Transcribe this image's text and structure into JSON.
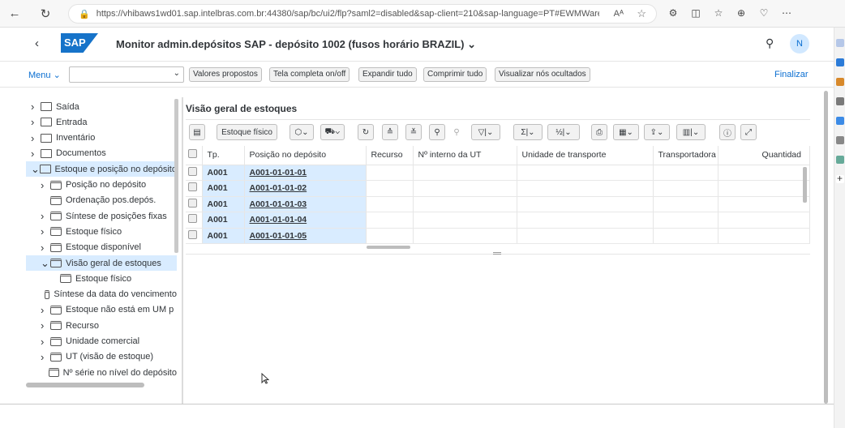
{
  "browser": {
    "url": "https://vhibaws1wd01.sap.intelbras.com.br:44380/sap/bc/ui2/flp?saml2=disabled&sap-client=210&sap-language=PT#EWMWareh...",
    "read_aloud": "Aᴬ"
  },
  "shell": {
    "title": "Monitor admin.depósitos SAP - depósito 1002 (fusos horário BRAZIL)",
    "title_chevron": "⌄",
    "avatar": "N",
    "logo": "SAP"
  },
  "toolbar": {
    "menu": "Menu",
    "buttons": [
      "Valores propostos",
      "Tela completa on/off",
      "Expandir tudo",
      "Comprimir tudo",
      "Visualizar nós ocultados"
    ],
    "finalizar": "Finalizar"
  },
  "tree": [
    {
      "label": "Saída",
      "icon": "folder-icon",
      "level": 0,
      "arrow": ">"
    },
    {
      "label": "Entrada",
      "icon": "folder-icon",
      "level": 0,
      "arrow": ">"
    },
    {
      "label": "Inventário",
      "icon": "folder-icon",
      "level": 0,
      "arrow": ">"
    },
    {
      "label": "Documentos",
      "icon": "folder-icon",
      "level": 0,
      "arrow": ">"
    },
    {
      "label": "Estoque e posição no depósito",
      "icon": "folder-open-icon",
      "level": 0,
      "arrow": "v",
      "selected": true
    },
    {
      "label": "Posição no depósito",
      "icon": "node-icon",
      "level": 1,
      "arrow": ">"
    },
    {
      "label": "Ordenação pos.depós.",
      "icon": "node-icon",
      "level": 1,
      "arrow": ""
    },
    {
      "label": "Síntese de posições fixas",
      "icon": "node-icon",
      "level": 1,
      "arrow": ">"
    },
    {
      "label": "Estoque físico",
      "icon": "node-icon",
      "level": 1,
      "arrow": ">"
    },
    {
      "label": "Estoque disponível",
      "icon": "node-icon",
      "level": 1,
      "arrow": ">"
    },
    {
      "label": "Visão geral de estoques",
      "icon": "node-icon",
      "level": 1,
      "arrow": "v",
      "selected": true
    },
    {
      "label": "Estoque físico",
      "icon": "node-icon",
      "level": 2,
      "arrow": "",
      "selected": true
    },
    {
      "label": "Síntese da data do vencimento",
      "icon": "node-icon",
      "level": 1,
      "arrow": ""
    },
    {
      "label": "Estoque não está em UM p",
      "icon": "node-icon",
      "level": 1,
      "arrow": ">"
    },
    {
      "label": "Recurso",
      "icon": "node-icon",
      "level": 1,
      "arrow": ">"
    },
    {
      "label": "Unidade comercial",
      "icon": "node-icon",
      "level": 1,
      "arrow": ">"
    },
    {
      "label": "UT (visão de estoque)",
      "icon": "node-icon",
      "level": 1,
      "arrow": ">"
    },
    {
      "label": "Nº série no nível do depósito",
      "icon": "node-icon",
      "level": 1,
      "arrow": ""
    }
  ],
  "panel": {
    "title": "Visão geral de estoques",
    "tool_label": "Estoque físico"
  },
  "table": {
    "headers": [
      "Tp.",
      "Posição no depósito",
      "Recurso",
      "Nº interno da UT",
      "Unidade de transporte",
      "Transportadora",
      "Quantidad"
    ],
    "rows": [
      [
        "A001",
        "A001-01-01-01"
      ],
      [
        "A001",
        "A001-01-01-02"
      ],
      [
        "A001",
        "A001-01-01-03"
      ],
      [
        "A001",
        "A001-01-01-04"
      ],
      [
        "A001",
        "A001-01-01-05"
      ]
    ]
  }
}
